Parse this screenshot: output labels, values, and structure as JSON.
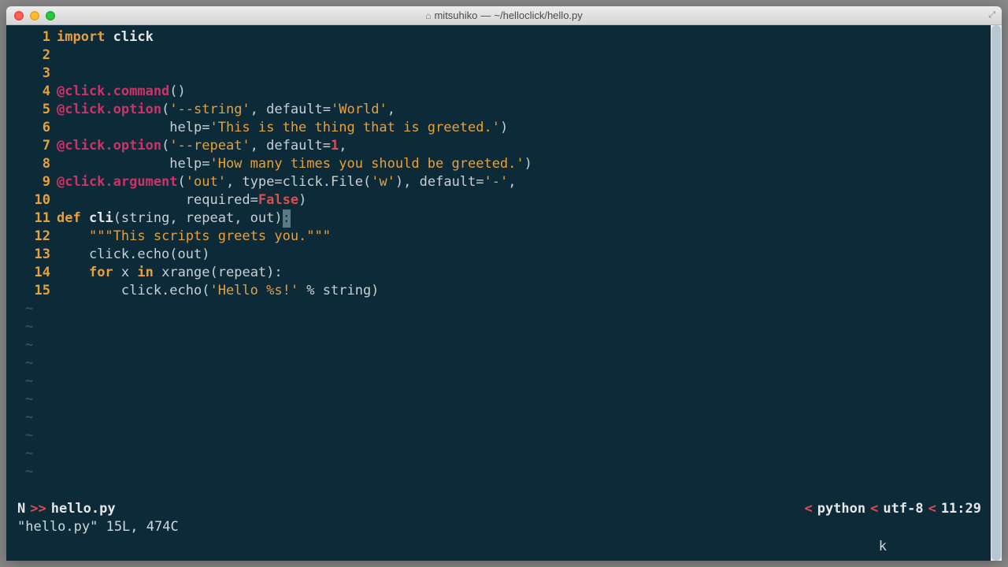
{
  "titlebar": {
    "user": "mitsuhiko",
    "path": "~/helloclick/hello.py"
  },
  "code": {
    "lines": [
      {
        "n": "1",
        "tokens": [
          [
            "kw",
            "import"
          ],
          [
            "punc",
            " "
          ],
          [
            "id",
            "click"
          ]
        ]
      },
      {
        "n": "2",
        "tokens": []
      },
      {
        "n": "3",
        "tokens": []
      },
      {
        "n": "4",
        "tokens": [
          [
            "deco",
            "@click.command"
          ],
          [
            "punc",
            "()"
          ]
        ]
      },
      {
        "n": "5",
        "tokens": [
          [
            "deco",
            "@click.option"
          ],
          [
            "punc",
            "("
          ],
          [
            "str",
            "'--string'"
          ],
          [
            "punc",
            ", default="
          ],
          [
            "str",
            "'World'"
          ],
          [
            "punc",
            ","
          ]
        ]
      },
      {
        "n": "6",
        "tokens": [
          [
            "punc",
            "              help="
          ],
          [
            "str",
            "'This is the thing that is greeted.'"
          ],
          [
            "punc",
            ")"
          ]
        ]
      },
      {
        "n": "7",
        "tokens": [
          [
            "deco",
            "@click.option"
          ],
          [
            "punc",
            "("
          ],
          [
            "str",
            "'--repeat'"
          ],
          [
            "punc",
            ", default="
          ],
          [
            "num",
            "1"
          ],
          [
            "punc",
            ","
          ]
        ]
      },
      {
        "n": "8",
        "tokens": [
          [
            "punc",
            "              help="
          ],
          [
            "str",
            "'How many times you should be greeted.'"
          ],
          [
            "punc",
            ")"
          ]
        ]
      },
      {
        "n": "9",
        "tokens": [
          [
            "deco",
            "@click.argument"
          ],
          [
            "punc",
            "("
          ],
          [
            "str",
            "'out'"
          ],
          [
            "punc",
            ", type=click.File("
          ],
          [
            "str",
            "'w'"
          ],
          [
            "punc",
            "), default="
          ],
          [
            "str",
            "'-'"
          ],
          [
            "punc",
            ","
          ]
        ]
      },
      {
        "n": "10",
        "tokens": [
          [
            "punc",
            "                required="
          ],
          [
            "const",
            "False"
          ],
          [
            "punc",
            ")"
          ]
        ]
      },
      {
        "n": "11",
        "tokens": [
          [
            "kw",
            "def"
          ],
          [
            "punc",
            " "
          ],
          [
            "fn",
            "cli"
          ],
          [
            "punc",
            "(string, repeat, out)"
          ],
          [
            "cursor",
            ":"
          ]
        ]
      },
      {
        "n": "12",
        "tokens": [
          [
            "punc",
            "    "
          ],
          [
            "str",
            "\"\"\"This scripts greets you.\"\"\""
          ]
        ]
      },
      {
        "n": "13",
        "tokens": [
          [
            "punc",
            "    click.echo(out)"
          ]
        ]
      },
      {
        "n": "14",
        "tokens": [
          [
            "punc",
            "    "
          ],
          [
            "kw",
            "for"
          ],
          [
            "punc",
            " x "
          ],
          [
            "kw",
            "in"
          ],
          [
            "punc",
            " xrange(repeat):"
          ]
        ]
      },
      {
        "n": "15",
        "tokens": [
          [
            "punc",
            "        click.echo("
          ],
          [
            "str",
            "'Hello %s!'"
          ],
          [
            "punc",
            " % string)"
          ]
        ]
      }
    ],
    "tilde_rows": 10,
    "tilde_char": "~"
  },
  "status": {
    "mode": "N",
    "chevron_right": ">>",
    "chevron_left": "<",
    "filename": "hello.py",
    "filetype": "python",
    "encoding": "utf-8",
    "position": "11:29"
  },
  "message": "\"hello.py\" 15L, 474C",
  "lastkey": "k"
}
